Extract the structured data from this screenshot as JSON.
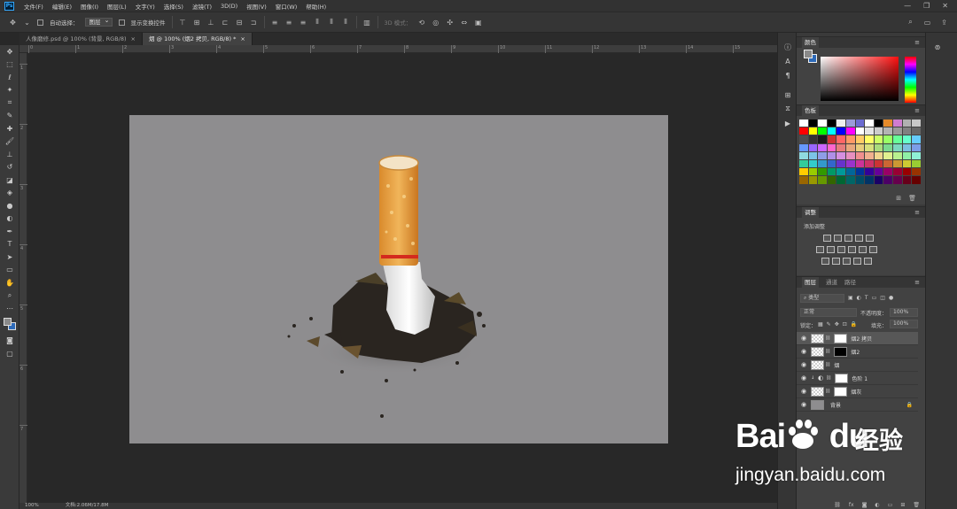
{
  "app": {
    "logo": "Ps"
  },
  "menu": [
    "文件(F)",
    "编辑(E)",
    "图像(I)",
    "图层(L)",
    "文字(Y)",
    "选择(S)",
    "滤镜(T)",
    "3D(D)",
    "视图(V)",
    "窗口(W)",
    "帮助(H)"
  ],
  "window_controls": {
    "minimize": "—",
    "restore": "❐",
    "close": "✕"
  },
  "options": {
    "auto_select_label": "自动选择：",
    "auto_select_value": "图层",
    "show_transform_label": "显示变换控件",
    "mode_3d_label": "3D 模式："
  },
  "tabs": [
    {
      "label": "人像磨修.psd @ 100% (背景, RGB/8)",
      "close": "×",
      "active": false
    },
    {
      "label": "烟 @ 100% (烟2 拷贝, RGB/8) *",
      "close": "×",
      "active": true
    }
  ],
  "ruler_top_labels": [
    "0",
    "1",
    "2",
    "3",
    "4",
    "5",
    "6",
    "7",
    "8",
    "9",
    "10",
    "11",
    "12",
    "13",
    "14",
    "15",
    "16"
  ],
  "ruler_left_labels": [
    "1",
    "2",
    "3",
    "4",
    "5",
    "6",
    "7"
  ],
  "status": {
    "zoom": "100%",
    "doc": "文档:2.06M/17.8M"
  },
  "panels": {
    "color": {
      "tab": "颜色",
      "fg": "#8a8a8a",
      "bg": "#2e6ab8"
    },
    "swatches": {
      "tab": "色板",
      "colors": [
        "#ffffff",
        "#000000",
        "#ffffff",
        "#000000",
        "#eeeeee",
        "#9b9bd9",
        "#6b6bd1",
        "#ffffff",
        "#000000",
        "#e48a2a",
        "#d07cd0",
        "#b0b0b0",
        "#c8c8c8",
        "#ff0000",
        "#ffff00",
        "#00ff00",
        "#00ffff",
        "#0000ff",
        "#ff00ff",
        "#ffffff",
        "#e5e5e5",
        "#cccccc",
        "#b3b3b3",
        "#999999",
        "#808080",
        "#666666",
        "#4d4d4d",
        "#333333",
        "#1a1a1a",
        "#cc3333",
        "#ff6666",
        "#ff9966",
        "#ffcc66",
        "#ffff66",
        "#ccff66",
        "#99ff66",
        "#66ff99",
        "#66ffcc",
        "#66ccff",
        "#6699ff",
        "#9966ff",
        "#cc66ff",
        "#ff66cc",
        "#e77c7c",
        "#e8a77c",
        "#e8cd7c",
        "#d8e07c",
        "#a9dc7c",
        "#7cd98f",
        "#7cd7bf",
        "#7cbfe0",
        "#7c9de8",
        "#8fd9e0",
        "#7cc4e8",
        "#8f9de8",
        "#b08fe8",
        "#d68fe0",
        "#e88fbf",
        "#f08f8f",
        "#f0b08f",
        "#f0d68f",
        "#e0f08f",
        "#b8f08f",
        "#8ff0a6",
        "#8ff0d6",
        "#33cc99",
        "#33cccc",
        "#3399cc",
        "#3366cc",
        "#6633cc",
        "#9933cc",
        "#cc3399",
        "#cc3366",
        "#cc3333",
        "#cc6633",
        "#cc9933",
        "#cccc33",
        "#99cc33",
        "#ffcc00",
        "#99cc00",
        "#339900",
        "#009966",
        "#009999",
        "#006699",
        "#003399",
        "#330099",
        "#660099",
        "#990066",
        "#990033",
        "#990000",
        "#993300",
        "#996600",
        "#999900",
        "#669900",
        "#336600",
        "#006633",
        "#006666",
        "#004c66",
        "#003366",
        "#1a0066",
        "#4c0066",
        "#66004c",
        "#66001a",
        "#660000"
      ]
    },
    "adjustments": {
      "tab": "调整",
      "add_label": "添加调整"
    },
    "layers": {
      "tabs": [
        "图层",
        "通道",
        "路径"
      ],
      "filter_kind": "类型",
      "blend_mode": "正常",
      "opacity_label": "不透明度：",
      "opacity_value": "100%",
      "lock_label": "锁定：",
      "fill_label": "填充：",
      "fill_value": "100%",
      "items": [
        {
          "name": "烟2 拷贝",
          "mask": "#ffffff",
          "selected": true
        },
        {
          "name": "烟2",
          "mask": "#000000",
          "selected": false
        },
        {
          "name": "烟",
          "mask": "",
          "selected": false
        },
        {
          "name": "色阶 1",
          "mask": "#ffffff",
          "selected": false
        },
        {
          "name": "烟灰",
          "mask": "#ffffff",
          "selected": false
        },
        {
          "name": "背景",
          "mask": "",
          "selected": false
        }
      ]
    }
  },
  "watermark": {
    "logo": "Bai",
    "logo_tail": "du",
    "cn": "经验",
    "url": "jingyan.baidu.com"
  }
}
